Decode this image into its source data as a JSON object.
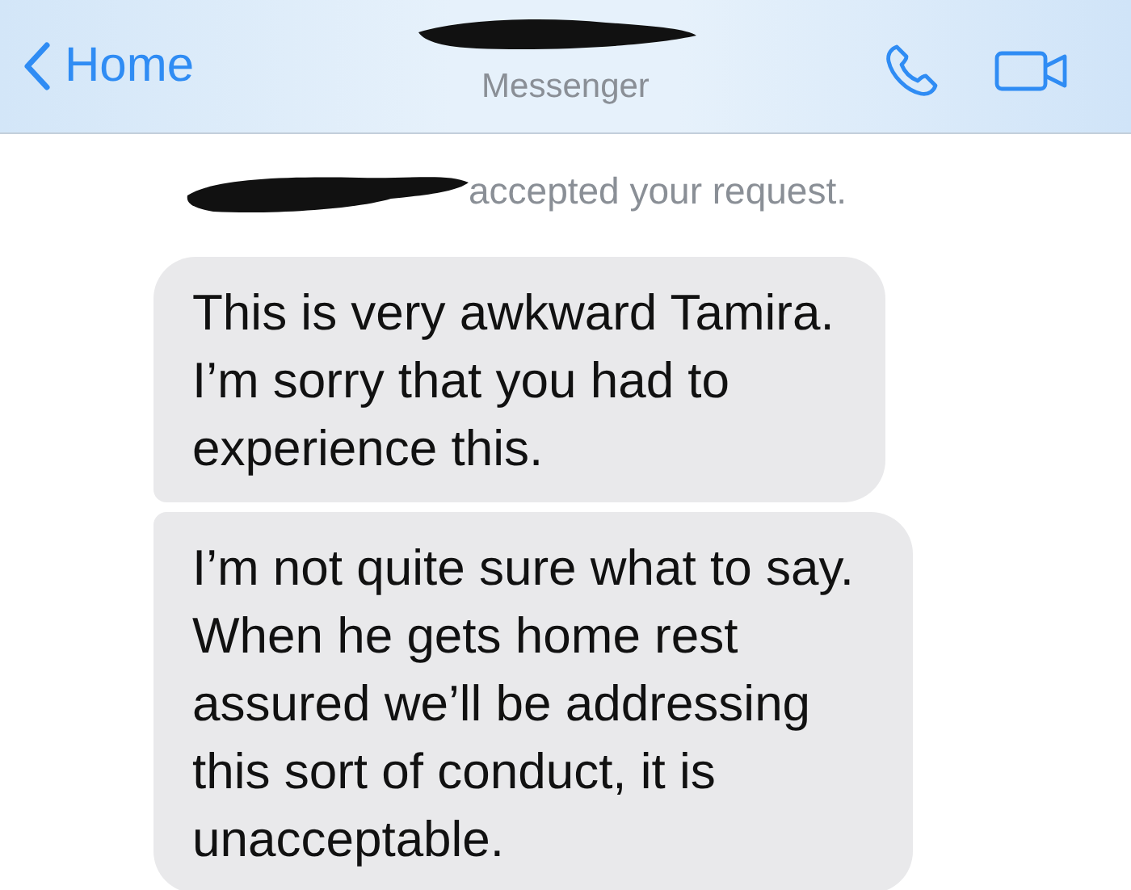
{
  "header": {
    "back_label": "Home",
    "subtitle": "Messenger"
  },
  "notice": "accepted your request.",
  "messages": [
    {
      "lines": [
        "This is very awkward Tamira.",
        "I’m sorry that you had to",
        "experience this."
      ]
    },
    {
      "lines": [
        "I’m not quite sure what to say.",
        "When he gets home rest",
        "assured we’ll be addressing",
        "this sort of conduct, it is",
        "unacceptable."
      ]
    }
  ]
}
